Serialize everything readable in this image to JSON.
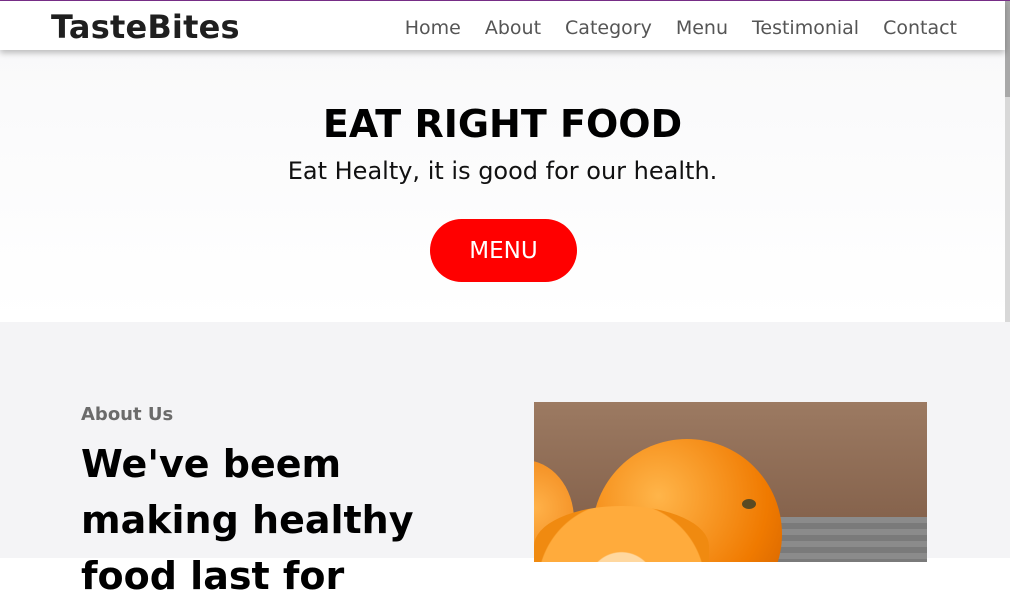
{
  "brand": "TasteBites",
  "nav": {
    "links": [
      "Home",
      "About",
      "Category",
      "Menu",
      "Testimonial",
      "Contact"
    ]
  },
  "hero": {
    "title": "EAT RIGHT FOOD",
    "subtitle": "Eat Healty, it is good for our health.",
    "button_label": "MENU"
  },
  "about": {
    "label": "About Us",
    "heading": "We've beem making healthy food last for"
  },
  "colors": {
    "accent": "#ff0000",
    "brand_text": "#1f1f1f",
    "nav_text": "#555555",
    "about_bg": "#f4f4f6"
  }
}
